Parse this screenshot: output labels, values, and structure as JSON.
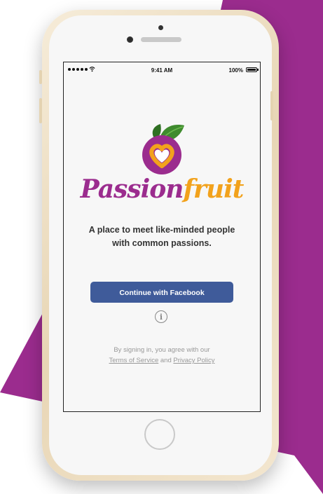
{
  "status_bar": {
    "time": "9:41 AM",
    "battery": "100%",
    "battery_level": 1.0
  },
  "brand": {
    "part1": "Passion",
    "part2": "fruit"
  },
  "tagline": {
    "line1": "A place to meet like-minded people",
    "line2": "with common passions."
  },
  "facebook_button": {
    "label": "Continue with Facebook"
  },
  "info_button": {
    "glyph": "i"
  },
  "terms": {
    "prefix": "By signing in, you agree with our",
    "terms_link": "Terms of Service",
    "and": "and",
    "privacy_link": "Privacy Policy"
  },
  "colors": {
    "purple": "#9b2c8e",
    "orange": "#f2a21c",
    "leaf_green": "#3f8b2e",
    "facebook_blue": "#3f5b9a"
  }
}
